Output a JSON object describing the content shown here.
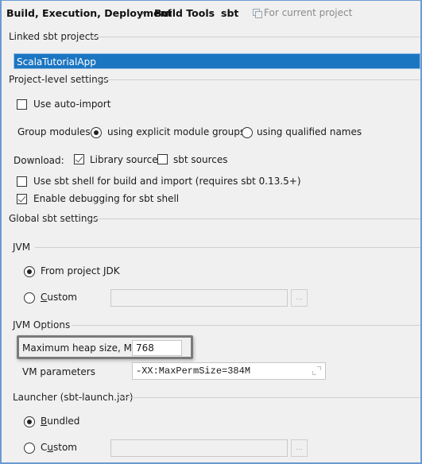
{
  "breadcrumb": {
    "items": [
      "Build, Execution, Deployment",
      "Build Tools",
      "sbt"
    ],
    "separator": "›",
    "scope_hint": "For current project",
    "scope_icon": "copy-icon"
  },
  "linked_projects": {
    "title": "Linked sbt projects",
    "items": [
      {
        "name": "ScalaTutorialApp",
        "selected": true
      }
    ]
  },
  "project_settings": {
    "title": "Project-level settings",
    "use_auto_import": {
      "label": "Use auto-import",
      "checked": false
    },
    "group_modules": {
      "label": "Group modules:",
      "options": [
        {
          "label": "using explicit module groups",
          "selected": true
        },
        {
          "label": "using qualified names",
          "selected": false
        }
      ]
    },
    "download": {
      "label": "Download:",
      "library_sources": {
        "label": "Library sources",
        "checked": true
      },
      "sbt_sources": {
        "label": "sbt sources",
        "checked": false
      }
    },
    "use_sbt_shell": {
      "label": "Use sbt shell for build and import (requires sbt 0.13.5+)",
      "checked": false
    },
    "enable_debugging": {
      "label": "Enable debugging for sbt shell",
      "checked": true
    }
  },
  "global_settings": {
    "title": "Global sbt settings",
    "jvm": {
      "title": "JVM",
      "from_project_jdk": {
        "label": "From project JDK",
        "selected": true
      },
      "custom": {
        "label": "Custom",
        "selected": false,
        "path": "",
        "browse_label": "..."
      }
    },
    "jvm_options": {
      "title": "JVM Options",
      "max_heap": {
        "label": "Maximum heap size, MB",
        "value": "768"
      },
      "vm_parameters": {
        "label": "VM parameters",
        "value": "-XX:MaxPermSize=384M"
      }
    },
    "launcher": {
      "title": "Launcher (sbt-launch.jar)",
      "bundled": {
        "label": "Bundled",
        "selected": true
      },
      "custom": {
        "label": "Custom",
        "selected": false,
        "path": "",
        "browse_label": "..."
      }
    }
  },
  "colors": {
    "selection": "#1b76c2",
    "window_border": "#6a9bd2",
    "highlight_box": "#7a7a7a"
  }
}
